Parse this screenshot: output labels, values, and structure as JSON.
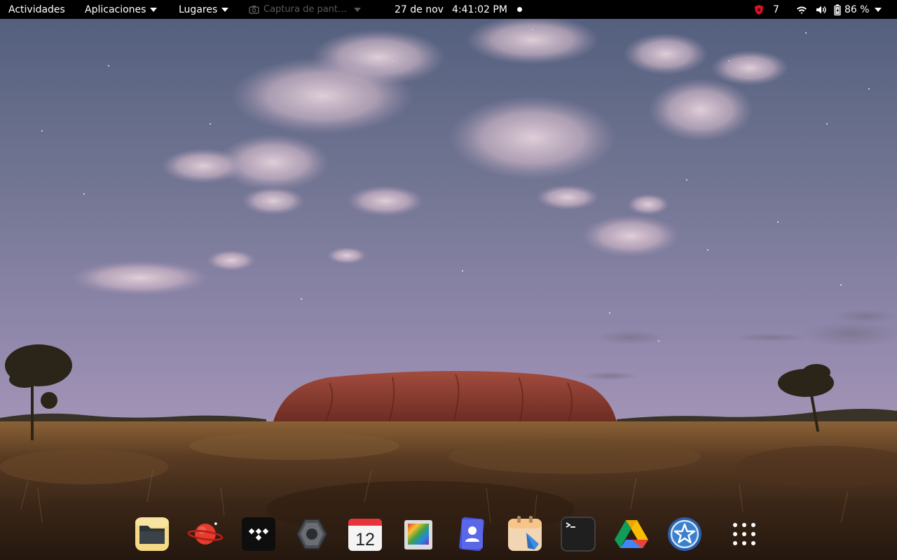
{
  "topbar": {
    "activities": "Actividades",
    "applications": "Aplicaciones",
    "places": "Lugares",
    "focused_app": "Captura de pant…",
    "date": "27 de nov",
    "time": "4:41:02 PM",
    "security_count": "7",
    "battery_percent": "86 %"
  },
  "colors": {
    "panel_bg": "#000000",
    "panel_text": "#ffffff",
    "shield_red": "#e0102a"
  },
  "icons": {
    "focused_app_icon": "screenshot-camera-icon",
    "notification_dot": "notification-dot-icon",
    "security": "shield-icon",
    "wifi": "wifi-icon",
    "volume": "speaker-volume-icon",
    "battery": "battery-charging-icon"
  },
  "dock": {
    "calendar_day": "12",
    "apps": [
      {
        "id": "files",
        "icon": "folder-icon"
      },
      {
        "id": "browser",
        "icon": "planet-saturn-icon"
      },
      {
        "id": "music",
        "icon": "tidal-icon"
      },
      {
        "id": "settings",
        "icon": "hexagon-nut-icon"
      },
      {
        "id": "calendar",
        "icon": "calendar-icon"
      },
      {
        "id": "image-viewer",
        "icon": "photos-icon"
      },
      {
        "id": "contacts",
        "icon": "contacts-icon"
      },
      {
        "id": "notes",
        "icon": "notes-icon"
      },
      {
        "id": "terminal",
        "icon": "terminal-icon"
      },
      {
        "id": "drive",
        "icon": "google-drive-icon"
      },
      {
        "id": "software",
        "icon": "star-badge-icon"
      },
      {
        "id": "show-apps",
        "icon": "app-grid-icon"
      }
    ]
  }
}
